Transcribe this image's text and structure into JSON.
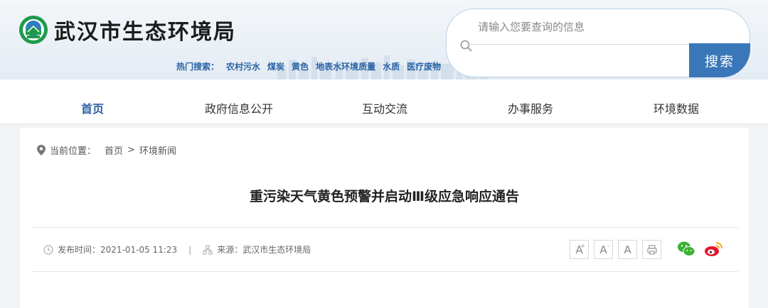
{
  "site": {
    "title": "武汉市生态环境局",
    "logo_icon": "mee-emblem-icon"
  },
  "search": {
    "placeholder": "请输入您要查询的信息",
    "button_label": "搜索"
  },
  "hot_search": {
    "label": "热门搜索：",
    "items": [
      "农村污水",
      "煤炭",
      "黄色",
      "地表水环境质量",
      "水质",
      "医疗废物"
    ]
  },
  "nav": {
    "items": [
      {
        "label": "首页",
        "active": true
      },
      {
        "label": "政府信息公开",
        "active": false
      },
      {
        "label": "互动交流",
        "active": false
      },
      {
        "label": "办事服务",
        "active": false
      },
      {
        "label": "环境数据",
        "active": false
      }
    ]
  },
  "breadcrumb": {
    "label": "当前位置：",
    "items": [
      "首页",
      "环境新闻"
    ],
    "separator": ">"
  },
  "article": {
    "title": "重污染天气黄色预警并启动Ⅲ级应急响应通告",
    "publish_label": "发布时间：2021-01-05 11:23",
    "divider": "|",
    "source_label": "来源：武汉市生态环境局"
  },
  "tools": {
    "font_large": "A",
    "font_small": "A",
    "font_default": "A",
    "large_mark": "+",
    "small_mark": "-",
    "print_icon": "print-icon"
  },
  "share": {
    "wechat_icon": "wechat-icon",
    "weibo_icon": "weibo-icon"
  },
  "colors": {
    "accent": "#3a77b8",
    "nav_active": "#2a5da0",
    "hot_link": "#2a63a8",
    "wechat": "#3cb034",
    "weibo": "#e6162d"
  }
}
